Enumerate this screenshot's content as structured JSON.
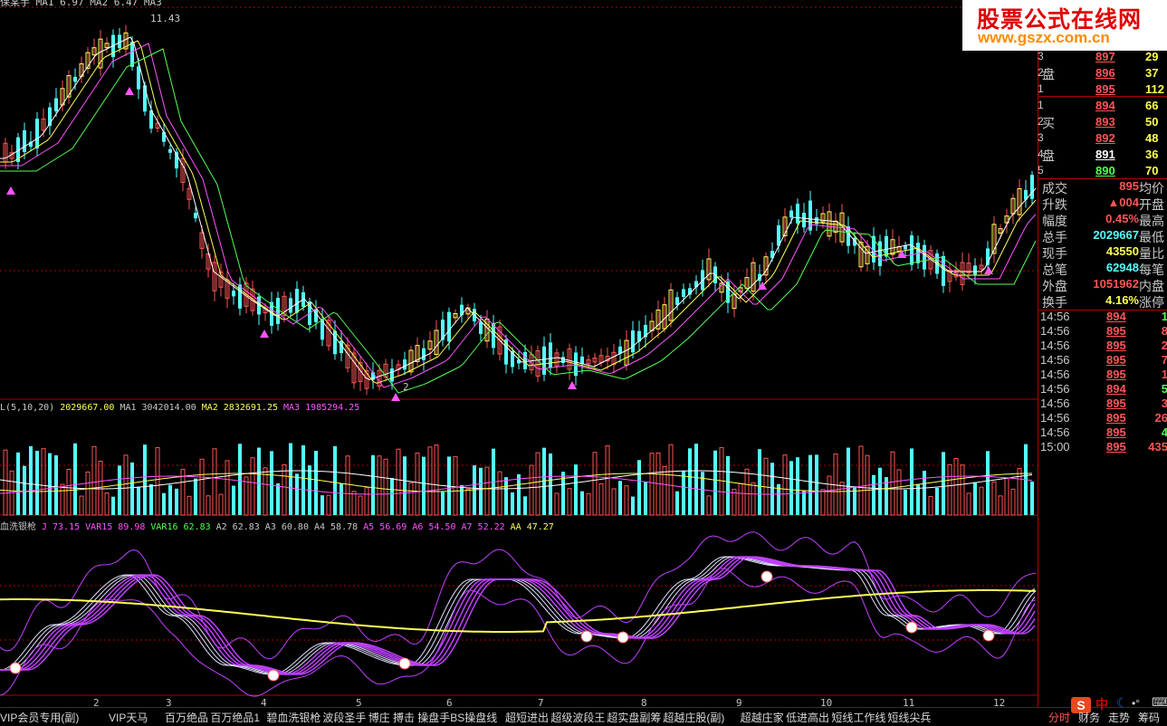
{
  "main_chart": {
    "title_fragment": "保某手 MA1 6.97 MA2 6.47 MA3",
    "peak_label": "11.43",
    "low_label": "2",
    "colors": {
      "up": "#ff5555",
      "down": "#54ffff",
      "ma_white": "#ffffff",
      "ma_yellow": "#ffff54",
      "ma_magenta": "#ff54ff",
      "ma_green": "#54ff54",
      "grid": "#b00000"
    }
  },
  "volume_panel": {
    "label": "L(5,10,20)",
    "values": [
      {
        "text": "2029667.00",
        "color": "#ffff54"
      },
      {
        "text": "MA1",
        "color": "#c8c8c8"
      },
      {
        "text": "3042014.00",
        "color": "#c8c8c8"
      },
      {
        "text": "MA2",
        "color": "#ffff54"
      },
      {
        "text": "2832691.25",
        "color": "#ffff54"
      },
      {
        "text": "MA3",
        "color": "#ff54ff"
      },
      {
        "text": "1985294.25",
        "color": "#ff54ff"
      }
    ]
  },
  "indicator_panel": {
    "name": "血洗银枪",
    "values": [
      {
        "text": "J 73.15",
        "color": "#ff54ff"
      },
      {
        "text": "VAR15 89.98",
        "color": "#ff54ff"
      },
      {
        "text": "VAR16 62.83",
        "color": "#54ff54"
      },
      {
        "text": "A2 62.83",
        "color": "#c8c8c8"
      },
      {
        "text": "A3 60.80",
        "color": "#c8c8c8"
      },
      {
        "text": "A4 58.78",
        "color": "#c8c8c8"
      },
      {
        "text": "A5 56.69",
        "color": "#ff54ff"
      },
      {
        "text": "A6 54.50",
        "color": "#ff54ff"
      },
      {
        "text": "A7 52.22",
        "color": "#ff54ff"
      },
      {
        "text": "AA 47.27",
        "color": "#ffff54"
      }
    ]
  },
  "x_axis": [
    "2",
    "3",
    "4",
    "5",
    "6",
    "7",
    "8",
    "9",
    "10",
    "11",
    "12"
  ],
  "logo": {
    "title": "股票公式在线网",
    "url": "www.gszx.com.cn"
  },
  "order_book": {
    "sell_label_1": "盘",
    "buy_label_1": "买",
    "buy_label_2": "盘",
    "sell": [
      {
        "idx": "3",
        "price": "897",
        "vol": "29"
      },
      {
        "idx": "2",
        "price": "896",
        "vol": "37"
      },
      {
        "idx": "1",
        "price": "895",
        "vol": "112"
      }
    ],
    "buy": [
      {
        "idx": "1",
        "price": "894",
        "vol": "66"
      },
      {
        "idx": "2",
        "price": "893",
        "vol": "50"
      },
      {
        "idx": "3",
        "price": "892",
        "vol": "48"
      },
      {
        "idx": "4",
        "price": "891",
        "vol": "36"
      },
      {
        "idx": "5",
        "price": "890",
        "vol": "70"
      }
    ]
  },
  "stats": [
    {
      "label": "成交",
      "value": "895",
      "color": "#ff5555",
      "right": "均价"
    },
    {
      "label": "升跌",
      "value": "▲004",
      "color": "#ff5555",
      "right": "开盘"
    },
    {
      "label": "幅度",
      "value": "0.45%",
      "color": "#ff5555",
      "right": "最高"
    },
    {
      "label": "总手",
      "value": "2029667",
      "color": "#54ffff",
      "right": "最低"
    },
    {
      "label": "现手",
      "value": "43550",
      "color": "#ffff54",
      "right": "量比"
    },
    {
      "label": "总笔",
      "value": "62948",
      "color": "#54ffff",
      "right": "每笔"
    },
    {
      "label": "外盘",
      "value": "1051962",
      "color": "#ff5555",
      "right": "内盘"
    },
    {
      "label": "换手",
      "value": "4.16%",
      "color": "#ffff54",
      "right": "涨停"
    }
  ],
  "ticks": [
    {
      "time": "14:56",
      "price": "894",
      "vol": "1",
      "vcolor": "#54ff54"
    },
    {
      "time": "14:56",
      "price": "895",
      "vol": "8",
      "vcolor": "#ff5555"
    },
    {
      "time": "14:56",
      "price": "895",
      "vol": "2",
      "vcolor": "#ff5555"
    },
    {
      "time": "14:56",
      "price": "895",
      "vol": "7",
      "vcolor": "#ff5555"
    },
    {
      "time": "14:56",
      "price": "895",
      "vol": "1",
      "vcolor": "#ff5555"
    },
    {
      "time": "14:56",
      "price": "894",
      "vol": "5",
      "vcolor": "#54ff54"
    },
    {
      "time": "14:56",
      "price": "895",
      "vol": "3",
      "vcolor": "#ff5555"
    },
    {
      "time": "14:56",
      "price": "895",
      "vol": "26",
      "vcolor": "#ff5555"
    },
    {
      "time": "14:56",
      "price": "895",
      "vol": "4",
      "vcolor": "#54ff54"
    },
    {
      "time": "15:00",
      "price": "895",
      "vol": "435",
      "vcolor": "#ff5555"
    }
  ],
  "bottom_tabs": [
    "VIP会员专用(副)",
    "VIP天马",
    "百万绝品",
    "百万绝品1",
    "碧血洗银枪",
    "波段圣手",
    "博庄",
    "搏击",
    "操盘手BS操盘线",
    "超短进出",
    "超级波段王",
    "超实盘副筹",
    "超越庄股(副)",
    "超越庄家",
    "低进高出",
    "短线工作线",
    "短线尖兵"
  ],
  "right_tabs": [
    "分时",
    "财务",
    "走势",
    "筹码"
  ]
}
